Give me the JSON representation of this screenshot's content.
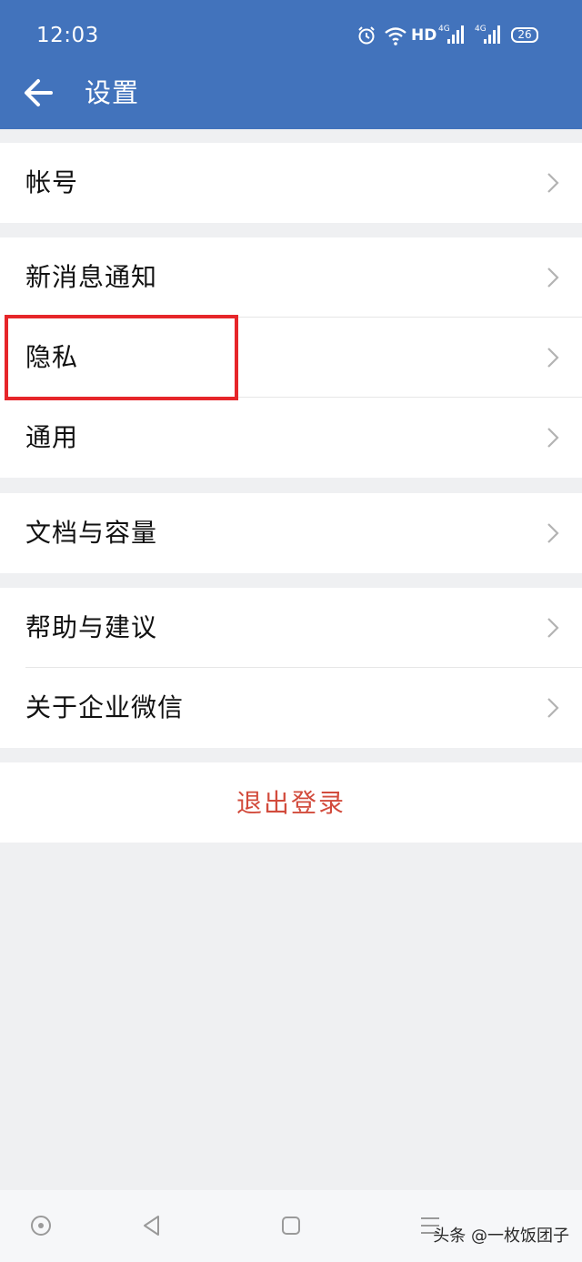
{
  "status_bar": {
    "time": "12:03",
    "network": "HD",
    "signal_1": "4G",
    "signal_2": "4G",
    "battery": "26",
    "icons": [
      "alarm-icon",
      "wifi-icon",
      "signal-icon",
      "signal-icon",
      "battery-icon"
    ]
  },
  "header": {
    "title": "设置",
    "back_icon": "arrow-left-icon"
  },
  "settings": {
    "account": "帐号",
    "notifications": "新消息通知",
    "privacy": "隐私",
    "general": "通用",
    "storage": "文档与容量",
    "help": "帮助与建议",
    "about": "关于企业微信"
  },
  "logout_label": "退出登录",
  "watermark": "头条 @一枚饭团子",
  "colors": {
    "header_bg": "#4273bc",
    "page_bg": "#eff0f2",
    "logout_text": "#d24b3c",
    "highlight_border": "#e6262a"
  }
}
